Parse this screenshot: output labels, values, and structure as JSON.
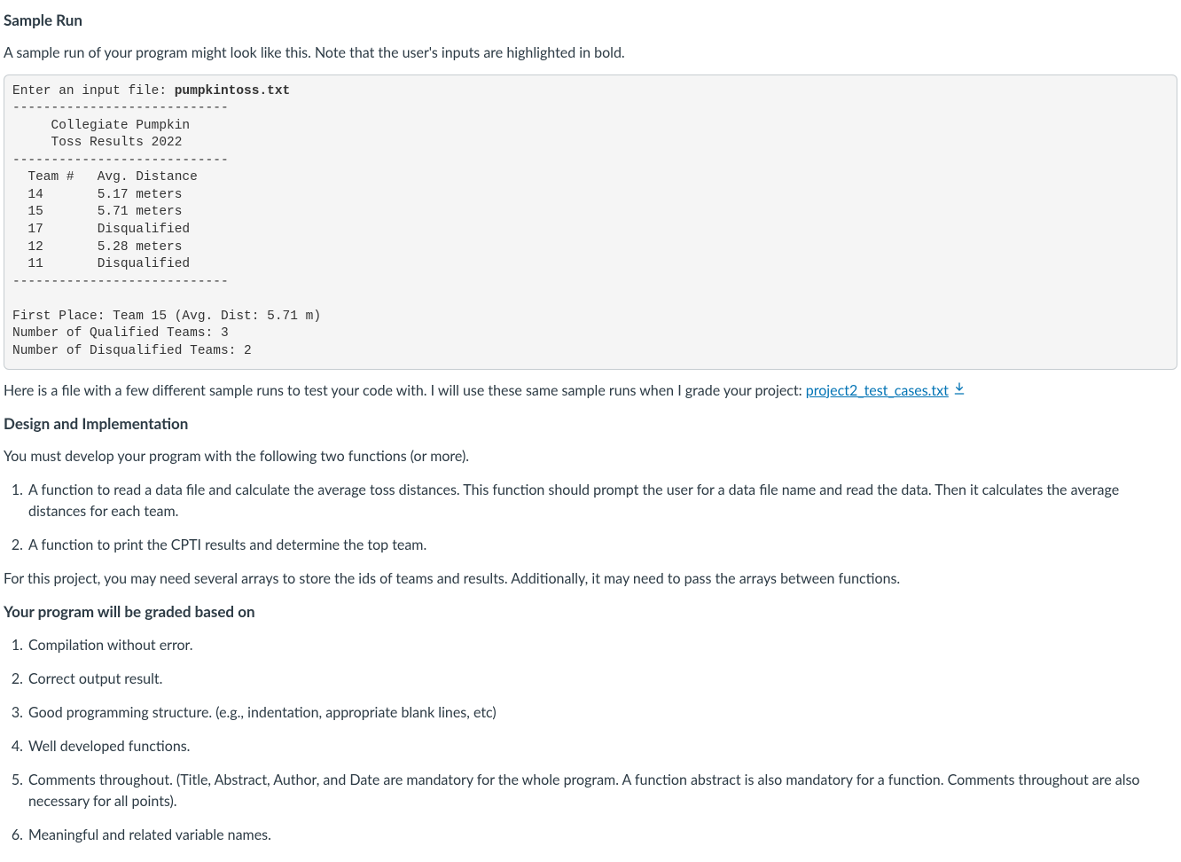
{
  "heading_sample_run": "Sample Run",
  "intro_paragraph": "A sample run of your program might look like this. Note that the user's inputs are highlighted in bold.",
  "sample_run": {
    "prompt": "Enter an input file: ",
    "user_input": "pumpkintoss.txt",
    "sep1": "----------------------------",
    "header_line1": "     Collegiate Pumpkin",
    "header_line2": "     Toss Results 2022",
    "sep2": "----------------------------",
    "col_header": "  Team #   Avg. Distance",
    "rows": [
      "  14       5.17 meters",
      "  15       5.71 meters",
      "  17       Disqualified",
      "  12       5.28 meters",
      "  11       Disqualified"
    ],
    "sep3": "----------------------------",
    "summary1": "First Place: Team 15 (Avg. Dist: 5.71 m)",
    "summary2": "Number of Qualified Teams: 3",
    "summary3": "Number of Disqualified Teams: 2"
  },
  "file_paragraph_prefix": "Here is a file with a few different sample runs to test your code with. I will use these same sample runs when I grade your project: ",
  "file_link_text": "project2_test_cases.txt",
  "heading_design": "Design and Implementation",
  "design_intro": "You must develop your program with the following two functions (or more).",
  "design_items": [
    "A function to read a data file and calculate the average toss distances. This function should prompt the user for a data file name and read the data. Then it calculates the average distances for each team.",
    "A function to print the CPTI results and determine the top team."
  ],
  "design_note": "For this project, you may need several arrays to store the ids of teams and results. Additionally, it may need to pass the arrays between functions.",
  "heading_grading": "Your program will be graded based on",
  "grading_items": [
    "Compilation without error.",
    "Correct output result.",
    "Good programming structure. (e.g., indentation, appropriate blank lines, etc)",
    "Well developed functions.",
    "Comments throughout. (Title, Abstract, Author, and Date are mandatory for the whole program. A function abstract is also mandatory for a function. Comments throughout are also necessary for all points).",
    "Meaningful and related variable names."
  ]
}
